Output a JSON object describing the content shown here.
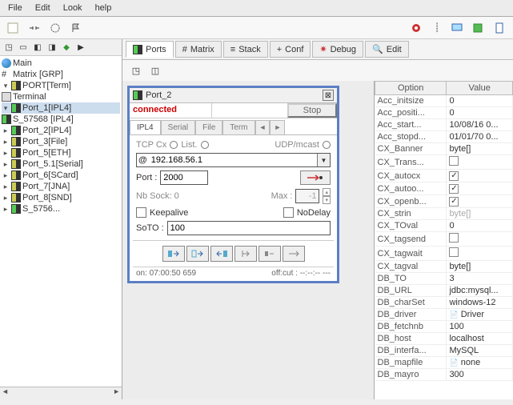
{
  "menu": {
    "file": "File",
    "edit": "Edit",
    "look": "Look",
    "help": "help"
  },
  "tree": {
    "root": "Main",
    "matrix": "Matrix [GRP]",
    "port_term": "PORT[Term]",
    "terminal": "Terminal",
    "port1": "Port_1[IPL4]",
    "s57568": "S_57568 [IPL4]",
    "port2": "Port_2[IPL4]",
    "port3": "Port_3[File]",
    "port5": "Port_5[ETH]",
    "port51": "Port_5.1[Serial]",
    "port6": "Port_6[SCard]",
    "port7": "Port_7[JNA]",
    "port8": "Port_8[SND]",
    "s5756": "S_5756..."
  },
  "tabs": {
    "ports": "Ports",
    "matrix": "Matrix",
    "stack": "Stack",
    "conf": "Conf",
    "debug": "Debug",
    "edit": "Edit"
  },
  "panel": {
    "title": "Port_2",
    "status": "connected",
    "stop": "Stop",
    "ptabs": {
      "ipl4": "IPL4",
      "serial": "Serial",
      "file": "File",
      "term": "Term"
    },
    "tcpcx": "TCP Cx",
    "list": "List.",
    "udp": "UDP/mcast",
    "ip": "192.168.56.1",
    "port_lbl": "Port :",
    "port_val": "2000",
    "nbsock": "Nb Sock: 0",
    "max": "Max :",
    "max_val": "-1",
    "keepalive": "Keepalive",
    "nodelay": "NoDelay",
    "soto": "SoTO :",
    "soto_val": "100",
    "on": "on: 07:00:50 659",
    "off": "off:cut : --:--:-- ---"
  },
  "options": {
    "hdr_opt": "Option",
    "hdr_val": "Value",
    "rows": [
      {
        "k": "Acc_initsize",
        "v": "0"
      },
      {
        "k": "Acc_positi...",
        "v": "0"
      },
      {
        "k": "Acc_start...",
        "v": "10/08/16 0..."
      },
      {
        "k": "Acc_stopd...",
        "v": "01/01/70 0..."
      },
      {
        "k": "CX_Banner",
        "v": "byte[]"
      },
      {
        "k": "CX_Trans...",
        "v": "",
        "chk": false
      },
      {
        "k": "CX_autocx",
        "v": "",
        "chk": true
      },
      {
        "k": "CX_autoo...",
        "v": "",
        "chk": true
      },
      {
        "k": "CX_openb...",
        "v": "",
        "chk": true
      },
      {
        "k": "CX_strin",
        "v": "byte[]",
        "gray": true
      },
      {
        "k": "CX_TOval",
        "v": "0"
      },
      {
        "k": "CX_tagsend",
        "v": "",
        "chk": false
      },
      {
        "k": "CX_tagwait",
        "v": "",
        "chk": false
      },
      {
        "k": "CX_tagval",
        "v": "byte[]"
      },
      {
        "k": "DB_TO",
        "v": "3"
      },
      {
        "k": "DB_URL",
        "v": "jdbc:mysql..."
      },
      {
        "k": "DB_charSet",
        "v": "windows-12"
      },
      {
        "k": "DB_driver",
        "v": "Driver",
        "icon": true
      },
      {
        "k": "DB_fetchnb",
        "v": "100"
      },
      {
        "k": "DB_host",
        "v": "localhost"
      },
      {
        "k": "DB_interfa...",
        "v": "MySQL"
      },
      {
        "k": "DB_mapfile",
        "v": "none",
        "icon": true
      },
      {
        "k": "DB_mayro",
        "v": "300"
      }
    ]
  }
}
